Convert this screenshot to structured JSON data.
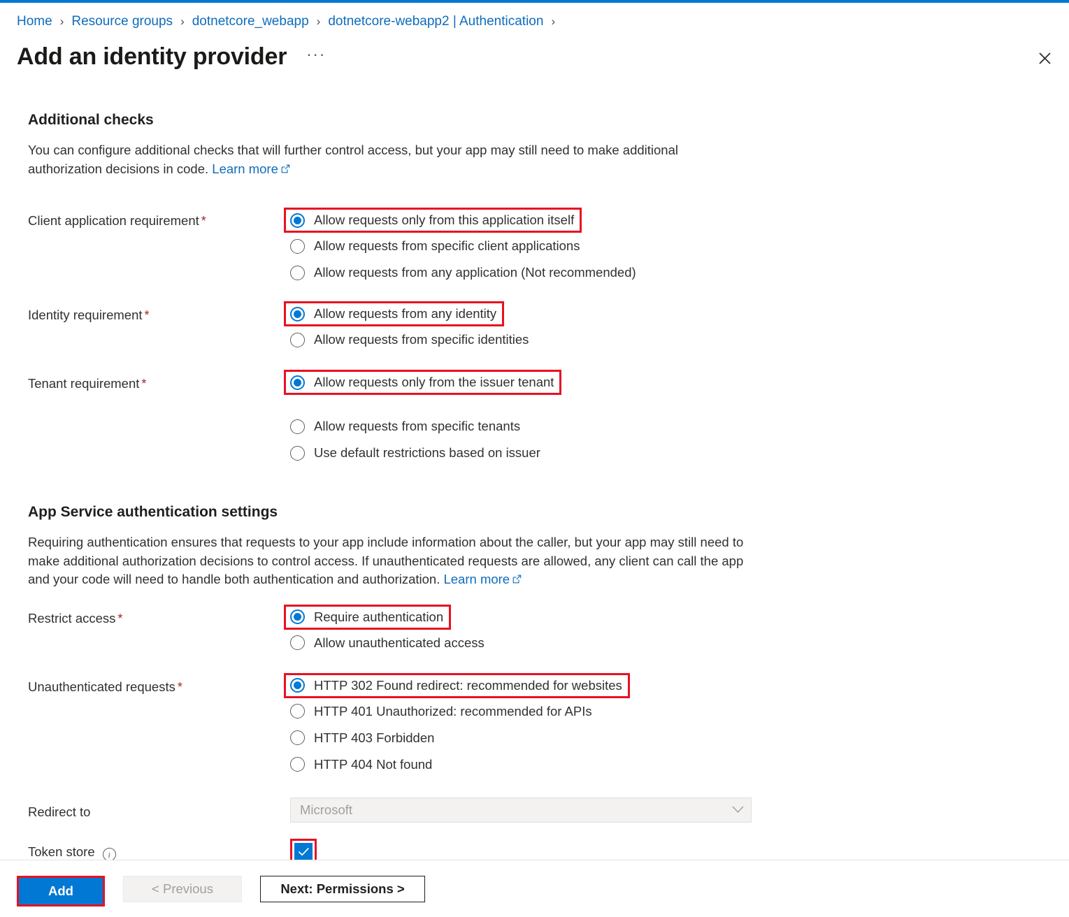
{
  "breadcrumb": {
    "items": [
      "Home",
      "Resource groups",
      "dotnetcore_webapp",
      "dotnetcore-webapp2 | Authentication"
    ],
    "separator": "›"
  },
  "header": {
    "title": "Add an identity provider",
    "more_label": "···",
    "close_icon": "close-icon"
  },
  "sections": {
    "additional_checks": {
      "heading": "Additional checks",
      "description_part1": "You can configure additional checks that will further control access, but your app may still need to make additional authorization decisions in code. ",
      "learn_more": "Learn more"
    },
    "app_service": {
      "heading": "App Service authentication settings",
      "description_part1": "Requiring authentication ensures that requests to your app include information about the caller, but your app may still need to make additional authorization decisions to control access. If unauthenticated requests are allowed, any client can call the app and your code will need to handle both authentication and authorization. ",
      "learn_more": "Learn more"
    }
  },
  "fields": {
    "client_application_requirement": {
      "label": "Client application requirement",
      "required": true,
      "options": [
        {
          "label": "Allow requests only from this application itself",
          "checked": true,
          "highlighted": true
        },
        {
          "label": "Allow requests from specific client applications",
          "checked": false,
          "highlighted": false
        },
        {
          "label": "Allow requests from any application (Not recommended)",
          "checked": false,
          "highlighted": false
        }
      ]
    },
    "identity_requirement": {
      "label": "Identity requirement",
      "required": true,
      "options": [
        {
          "label": "Allow requests from any identity",
          "checked": true,
          "highlighted": true
        },
        {
          "label": "Allow requests from specific identities",
          "checked": false,
          "highlighted": false
        }
      ]
    },
    "tenant_requirement": {
      "label": "Tenant requirement",
      "required": true,
      "options": [
        {
          "label": "Allow requests only from the issuer tenant",
          "checked": true,
          "highlighted": true
        },
        {
          "label": "Allow requests from specific tenants",
          "checked": false,
          "highlighted": false
        },
        {
          "label": "Use default restrictions based on issuer",
          "checked": false,
          "highlighted": false
        }
      ]
    },
    "restrict_access": {
      "label": "Restrict access",
      "required": true,
      "options": [
        {
          "label": "Require authentication",
          "checked": true,
          "highlighted": true
        },
        {
          "label": "Allow unauthenticated access",
          "checked": false,
          "highlighted": false
        }
      ]
    },
    "unauthenticated_requests": {
      "label": "Unauthenticated requests",
      "required": true,
      "options": [
        {
          "label": "HTTP 302 Found redirect: recommended for websites",
          "checked": true,
          "highlighted": true
        },
        {
          "label": "HTTP 401 Unauthorized: recommended for APIs",
          "checked": false,
          "highlighted": false
        },
        {
          "label": "HTTP 403 Forbidden",
          "checked": false,
          "highlighted": false
        },
        {
          "label": "HTTP 404 Not found",
          "checked": false,
          "highlighted": false
        }
      ]
    },
    "redirect_to": {
      "label": "Redirect to",
      "required": false,
      "value": "Microsoft",
      "disabled": true
    },
    "token_store": {
      "label": "Token store",
      "required": false,
      "info_icon": "info-icon",
      "checked": true,
      "highlighted": true
    }
  },
  "footer": {
    "add_label": "Add",
    "previous_label": "< Previous",
    "next_label": "Next: Permissions >"
  },
  "colors": {
    "accent": "#0078d4",
    "link": "#0f6cbd",
    "highlight": "#e81123",
    "required_star": "#a4262c",
    "text": "#323130"
  }
}
